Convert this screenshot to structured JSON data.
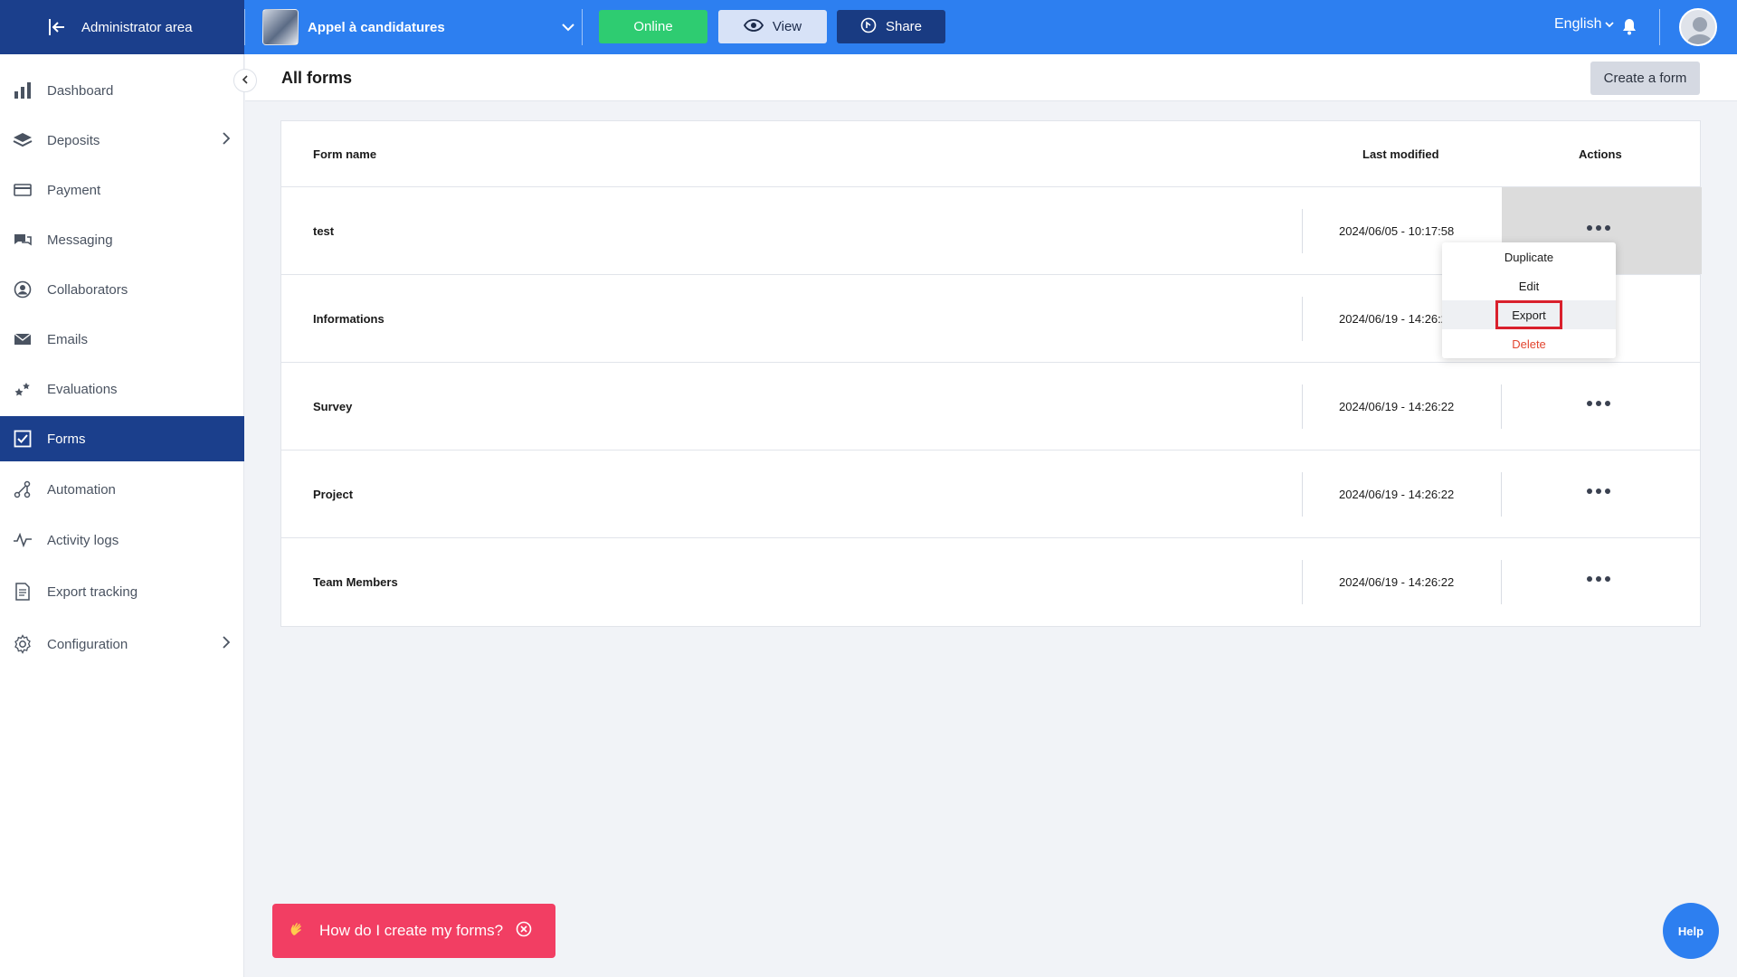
{
  "topbar": {
    "admin_label": "Administrator area",
    "event_name": "Appel à candidatures",
    "online_label": "Online",
    "view_label": "View",
    "share_label": "Share",
    "language": "English"
  },
  "sidebar": {
    "items": [
      {
        "label": "Dashboard",
        "icon": "bar-chart-icon"
      },
      {
        "label": "Deposits",
        "icon": "layers-icon"
      },
      {
        "label": "Payment",
        "icon": "credit-card-icon"
      },
      {
        "label": "Messaging",
        "icon": "chat-icon"
      },
      {
        "label": "Collaborators",
        "icon": "user-circle-icon"
      },
      {
        "label": "Emails",
        "icon": "envelope-icon"
      },
      {
        "label": "Evaluations",
        "icon": "stars-icon"
      },
      {
        "label": "Forms",
        "icon": "checkbox-icon"
      },
      {
        "label": "Automation",
        "icon": "automation-icon"
      },
      {
        "label": "Activity logs",
        "icon": "pulse-icon"
      },
      {
        "label": "Export tracking",
        "icon": "document-icon"
      },
      {
        "label": "Configuration",
        "icon": "gear-icon"
      }
    ]
  },
  "header": {
    "title": "All forms",
    "create_label": "Create a form"
  },
  "table": {
    "columns": [
      "Form name",
      "Last modified",
      "Actions"
    ],
    "rows": [
      {
        "name": "test",
        "modified": "2024/06/05 - 10:17:58"
      },
      {
        "name": "Informations",
        "modified": "2024/06/19 - 14:26:22"
      },
      {
        "name": "Survey",
        "modified": "2024/06/19 - 14:26:22"
      },
      {
        "name": "Project",
        "modified": "2024/06/19 - 14:26:22"
      },
      {
        "name": "Team Members",
        "modified": "2024/06/19 - 14:26:22"
      }
    ]
  },
  "dropdown": {
    "items": [
      "Duplicate",
      "Edit",
      "Export",
      "Delete"
    ]
  },
  "tip": {
    "text": "How do I create my forms?"
  },
  "help": {
    "label": "Help"
  },
  "colors": {
    "primary": "#2d7ff0",
    "navy": "#1b3f8c",
    "online": "#2ecc71",
    "danger": "#e2452f",
    "tip": "#f23e63"
  }
}
